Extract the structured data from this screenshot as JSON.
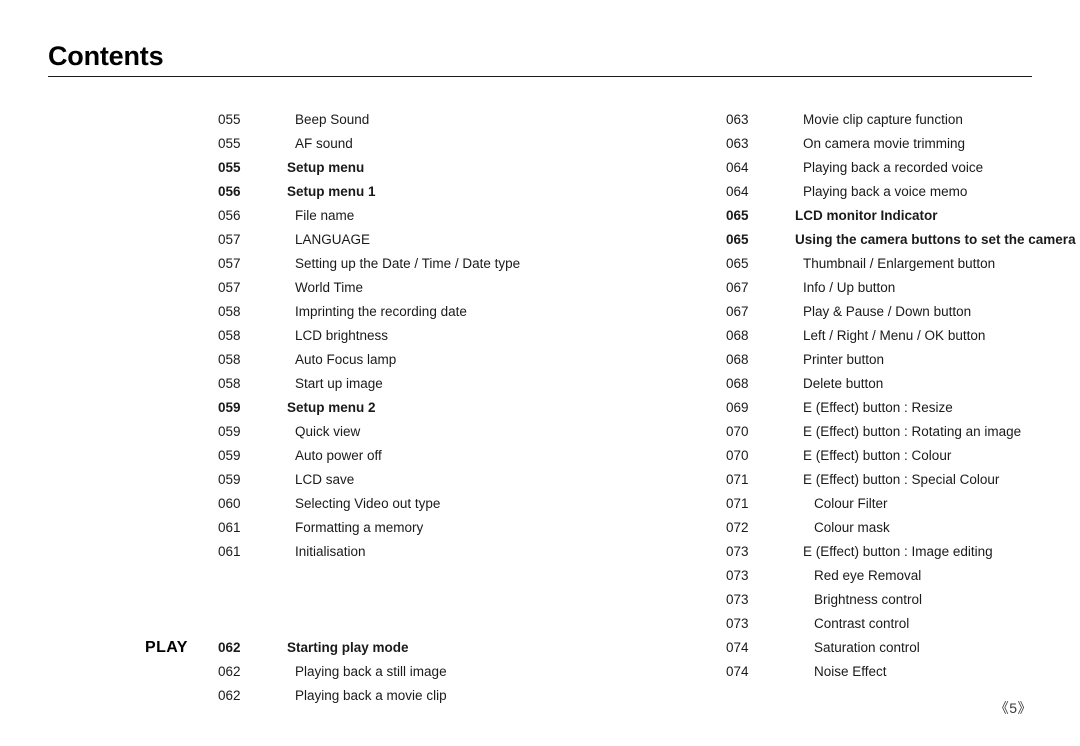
{
  "header": {
    "title": "Contents"
  },
  "footer": {
    "page_number": "《5》"
  },
  "columns": {
    "left": {
      "groups": [
        {
          "gutter_label": "",
          "entries": [
            {
              "page": "055",
              "label": "Beep Sound",
              "level": 1
            },
            {
              "page": "055",
              "label": "AF sound",
              "level": 1
            },
            {
              "page": "055",
              "label": "Setup menu",
              "level": 0
            },
            {
              "page": "056",
              "label": "Setup menu 1",
              "level": 0
            },
            {
              "page": "056",
              "label": "File name",
              "level": 1
            },
            {
              "page": "057",
              "label": "LANGUAGE",
              "level": 1
            },
            {
              "page": "057",
              "label": "Setting up the Date / Time / Date type",
              "level": 1
            },
            {
              "page": "057",
              "label": "World Time",
              "level": 1
            },
            {
              "page": "058",
              "label": "Imprinting the recording date",
              "level": 1
            },
            {
              "page": "058",
              "label": "LCD brightness",
              "level": 1
            },
            {
              "page": "058",
              "label": "Auto Focus lamp",
              "level": 1
            },
            {
              "page": "058",
              "label": "Start up image",
              "level": 1
            },
            {
              "page": "059",
              "label": "Setup menu 2",
              "level": 0
            },
            {
              "page": "059",
              "label": "Quick view",
              "level": 1
            },
            {
              "page": "059",
              "label": "Auto power off",
              "level": 1
            },
            {
              "page": "059",
              "label": "LCD save",
              "level": 1
            },
            {
              "page": "060",
              "label": "Selecting Video out type",
              "level": 1
            },
            {
              "page": "061",
              "label": "Formatting a memory",
              "level": 1
            },
            {
              "page": "061",
              "label": "Initialisation",
              "level": 1
            }
          ]
        },
        {
          "gutter_label": "PLAY",
          "entries": [
            {
              "page": "062",
              "label": "Starting play mode",
              "level": 0
            },
            {
              "page": "062",
              "label": "Playing back a still image",
              "level": 1
            },
            {
              "page": "062",
              "label": "Playing back a movie clip",
              "level": 1
            }
          ]
        }
      ]
    },
    "right": {
      "groups": [
        {
          "gutter_label": "",
          "entries": [
            {
              "page": "063",
              "label": "Movie clip capture function",
              "level": 1
            },
            {
              "page": "063",
              "label": "On camera movie trimming",
              "level": 1
            },
            {
              "page": "064",
              "label": "Playing back a recorded voice",
              "level": 1
            },
            {
              "page": "064",
              "label": "Playing back a voice memo",
              "level": 1
            },
            {
              "page": "065",
              "label": "LCD monitor Indicator",
              "level": 0
            },
            {
              "page": "065",
              "label": "Using the camera buttons to set the camera",
              "level": 0
            },
            {
              "page": "065",
              "label": "Thumbnail / Enlargement button",
              "level": 1
            },
            {
              "page": "067",
              "label": "Info / Up button",
              "level": 1
            },
            {
              "page": "067",
              "label": "Play & Pause / Down button",
              "level": 1
            },
            {
              "page": "068",
              "label": "Left / Right / Menu / OK button",
              "level": 1
            },
            {
              "page": "068",
              "label": "Printer button",
              "level": 1
            },
            {
              "page": "068",
              "label": "Delete button",
              "level": 1
            },
            {
              "page": "069",
              "label": "E (Effect) button : Resize",
              "level": 1
            },
            {
              "page": "070",
              "label": "E (Effect) button : Rotating an image",
              "level": 1
            },
            {
              "page": "070",
              "label": "E (Effect) button : Colour",
              "level": 1
            },
            {
              "page": "071",
              "label": "E (Effect) button : Special Colour",
              "level": 1
            },
            {
              "page": "071",
              "label": "Colour Filter",
              "level": 2
            },
            {
              "page": "072",
              "label": "Colour mask",
              "level": 2
            },
            {
              "page": "073",
              "label": "E (Effect) button : Image editing",
              "level": 1
            },
            {
              "page": "073",
              "label": "Red eye Removal",
              "level": 2
            },
            {
              "page": "073",
              "label": "Brightness control",
              "level": 2
            },
            {
              "page": "073",
              "label": "Contrast control",
              "level": 2
            },
            {
              "page": "074",
              "label": "Saturation control",
              "level": 2
            },
            {
              "page": "074",
              "label": "Noise Effect",
              "level": 2
            }
          ]
        }
      ]
    }
  }
}
